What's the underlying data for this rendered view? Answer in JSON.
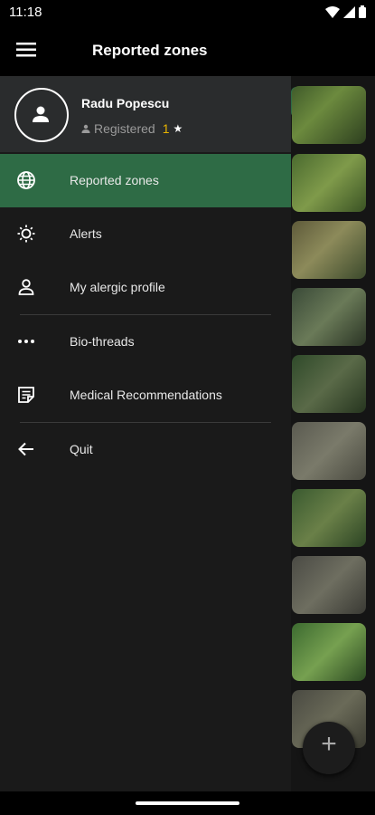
{
  "status": {
    "time": "11:18"
  },
  "appbar": {
    "title": "Reported zones"
  },
  "drawer": {
    "user": {
      "name": "Radu Popescu",
      "status": "Registered",
      "rating": "1"
    },
    "items": [
      {
        "label": "Reported zones",
        "icon": "globe-icon",
        "active": true
      },
      {
        "label": "Alerts",
        "icon": "sun-icon"
      },
      {
        "label": "My alergic profile",
        "icon": "person-icon"
      },
      {
        "label": "Bio-threads",
        "icon": "more-horizontal-icon"
      },
      {
        "label": "Medical Recommendations",
        "icon": "notes-icon"
      },
      {
        "label": "Quit",
        "icon": "arrow-back-icon"
      }
    ]
  },
  "fab": {
    "label": "+"
  },
  "colors": {
    "accent": "#2e6b45",
    "rating": "#e8b400"
  }
}
